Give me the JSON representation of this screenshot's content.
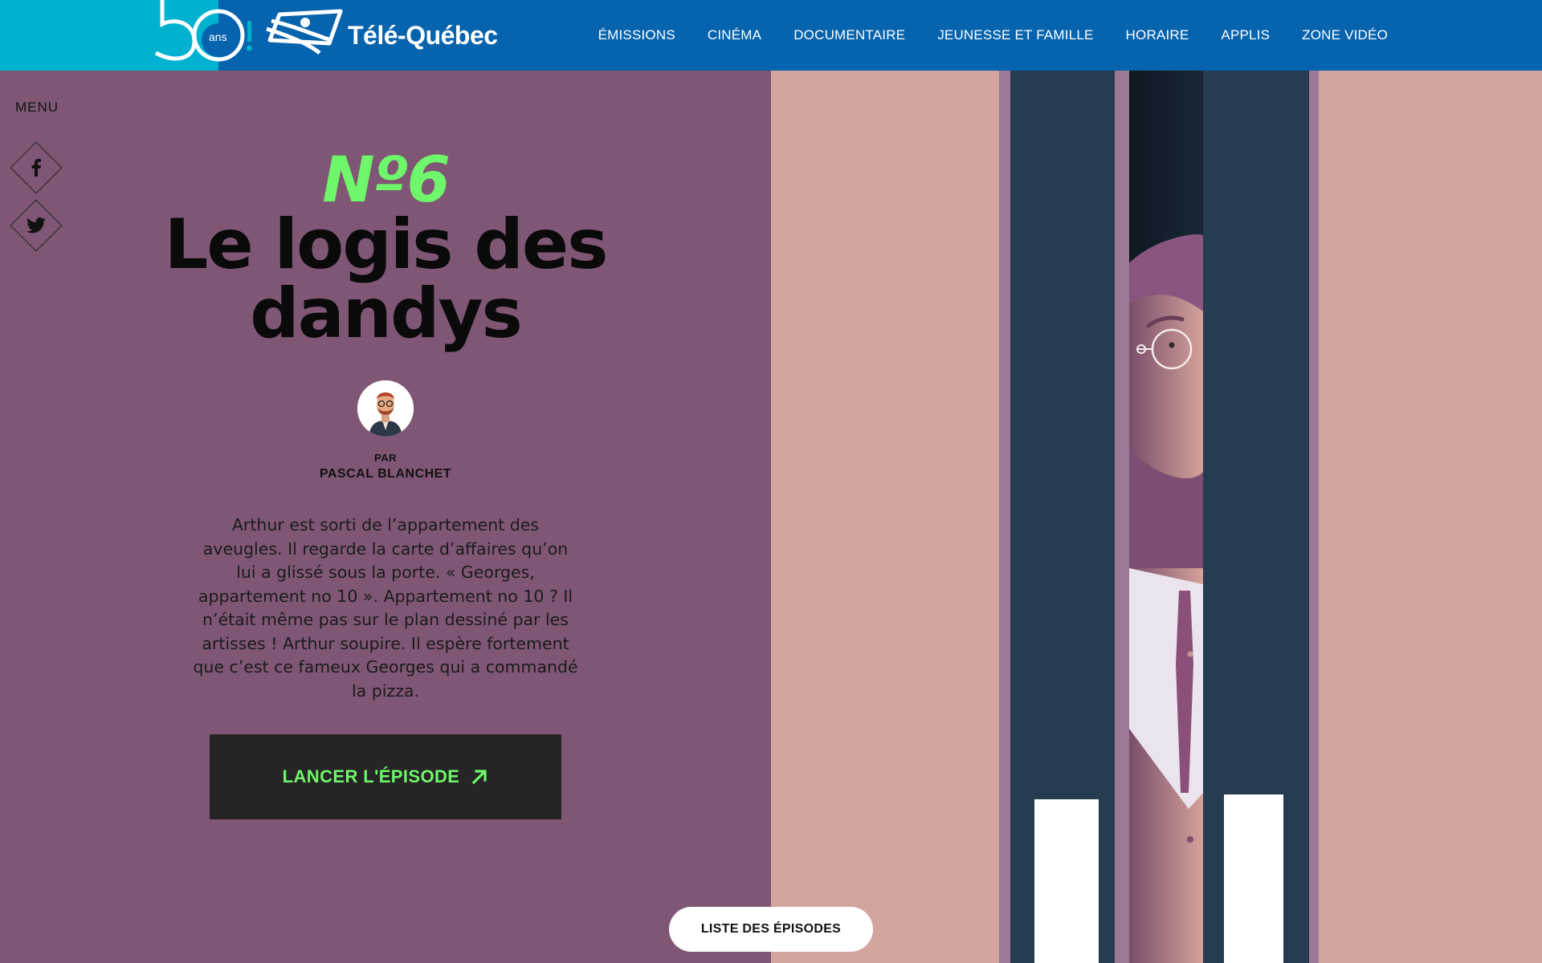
{
  "header": {
    "anniversary_number": "50",
    "anniversary_unit": "ans",
    "brand": "Télé-Québec",
    "nav": [
      {
        "label": "ÉMISSIONS"
      },
      {
        "label": "CINÉMA"
      },
      {
        "label": "DOCUMENTAIRE"
      },
      {
        "label": "JEUNESSE ET FAMILLE"
      },
      {
        "label": "HORAIRE"
      },
      {
        "label": "APPLIS"
      },
      {
        "label": "ZONE VIDÉO"
      }
    ]
  },
  "sidebar": {
    "menu_label": "MENU",
    "social": [
      {
        "icon": "facebook-icon"
      },
      {
        "icon": "twitter-icon"
      }
    ]
  },
  "episode": {
    "number": "Nº6",
    "title": "Le logis des dandys",
    "author_prefix": "PAR",
    "author_name": "PASCAL BLANCHET",
    "synopsis": "Arthur est sorti de l’appartement des aveugles. Il regarde la carte d’affaires qu’on lui a glissé sous la porte. « Georges, appartement no 10 ». Appartement no 10 ? Il n’était même pas sur le plan dessiné par les artisses ! Arthur soupire. Il espère fortement que c’est ce fameux Georges qui a commandé la pizza.",
    "launch_label": "LANCER L'ÉPISODE",
    "episodes_list_label": "LISTE DES ÉPISODES"
  },
  "colors": {
    "header_blue": "#0663ae",
    "header_teal": "#00b2cf",
    "panel_purple": "#7f5775",
    "accent_green": "#6ff76b",
    "button_dark": "#262424",
    "illustration_pink": "#d4a59e",
    "door_navy": "#263c50"
  }
}
